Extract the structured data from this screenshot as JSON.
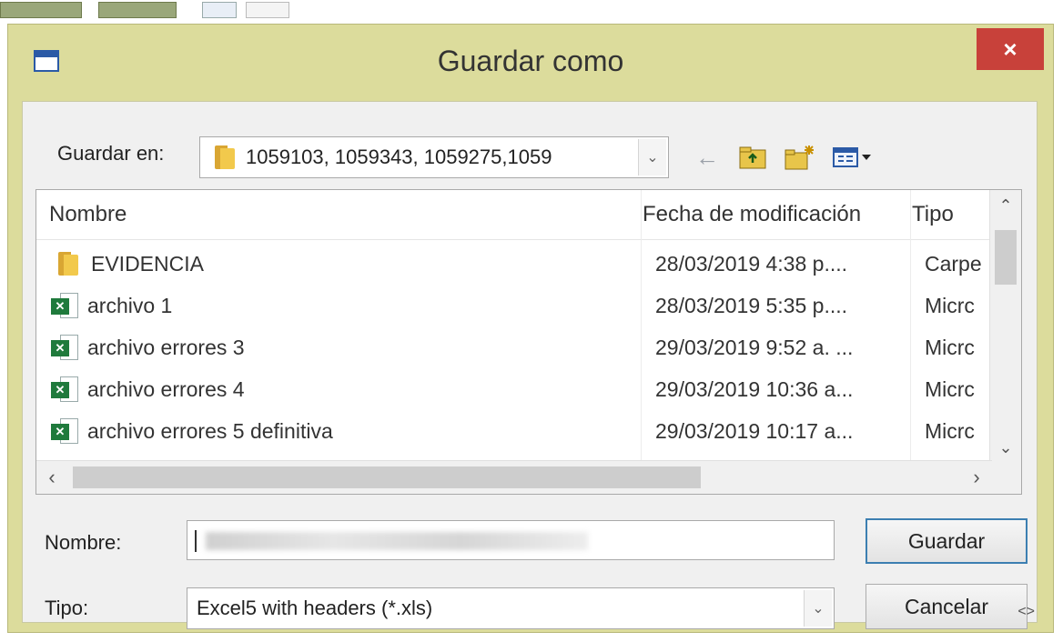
{
  "dialog": {
    "title": "Guardar como",
    "close_label": "×"
  },
  "save_in": {
    "label": "Guardar en:",
    "value": "1059103, 1059343, 1059275,1059"
  },
  "toolbar": {
    "back_icon": "back-arrow-icon",
    "up_icon": "up-folder-icon",
    "new_folder_icon": "new-folder-icon",
    "view_icon": "view-menu-icon"
  },
  "list": {
    "columns": [
      "Nombre",
      "Fecha de modificación",
      "Tipo"
    ],
    "rows": [
      {
        "icon": "folder-icon",
        "name": "EVIDENCIA",
        "date": "28/03/2019 4:38 p....",
        "type": "Carpe"
      },
      {
        "icon": "excel-file-icon",
        "name": "archivo 1",
        "date": "28/03/2019 5:35 p....",
        "type": "Micrc"
      },
      {
        "icon": "excel-file-icon",
        "name": "archivo errores 3",
        "date": "29/03/2019 9:52 a. ...",
        "type": "Micrc"
      },
      {
        "icon": "excel-file-icon",
        "name": "archivo errores 4",
        "date": "29/03/2019 10:36 a...",
        "type": "Micrc"
      },
      {
        "icon": "excel-file-icon",
        "name": "archivo errores 5 definitiva",
        "date": "29/03/2019 10:17 a...",
        "type": "Micrc"
      }
    ]
  },
  "filename": {
    "label": "Nombre:",
    "value": ""
  },
  "filetype": {
    "label": "Tipo:",
    "value": "Excel5 with headers (*.xls)"
  },
  "buttons": {
    "save": "Guardar",
    "cancel": "Cancelar"
  },
  "colors": {
    "frame": "#dcdc9c",
    "close": "#c8413a",
    "default_border": "#3c7fb1"
  }
}
